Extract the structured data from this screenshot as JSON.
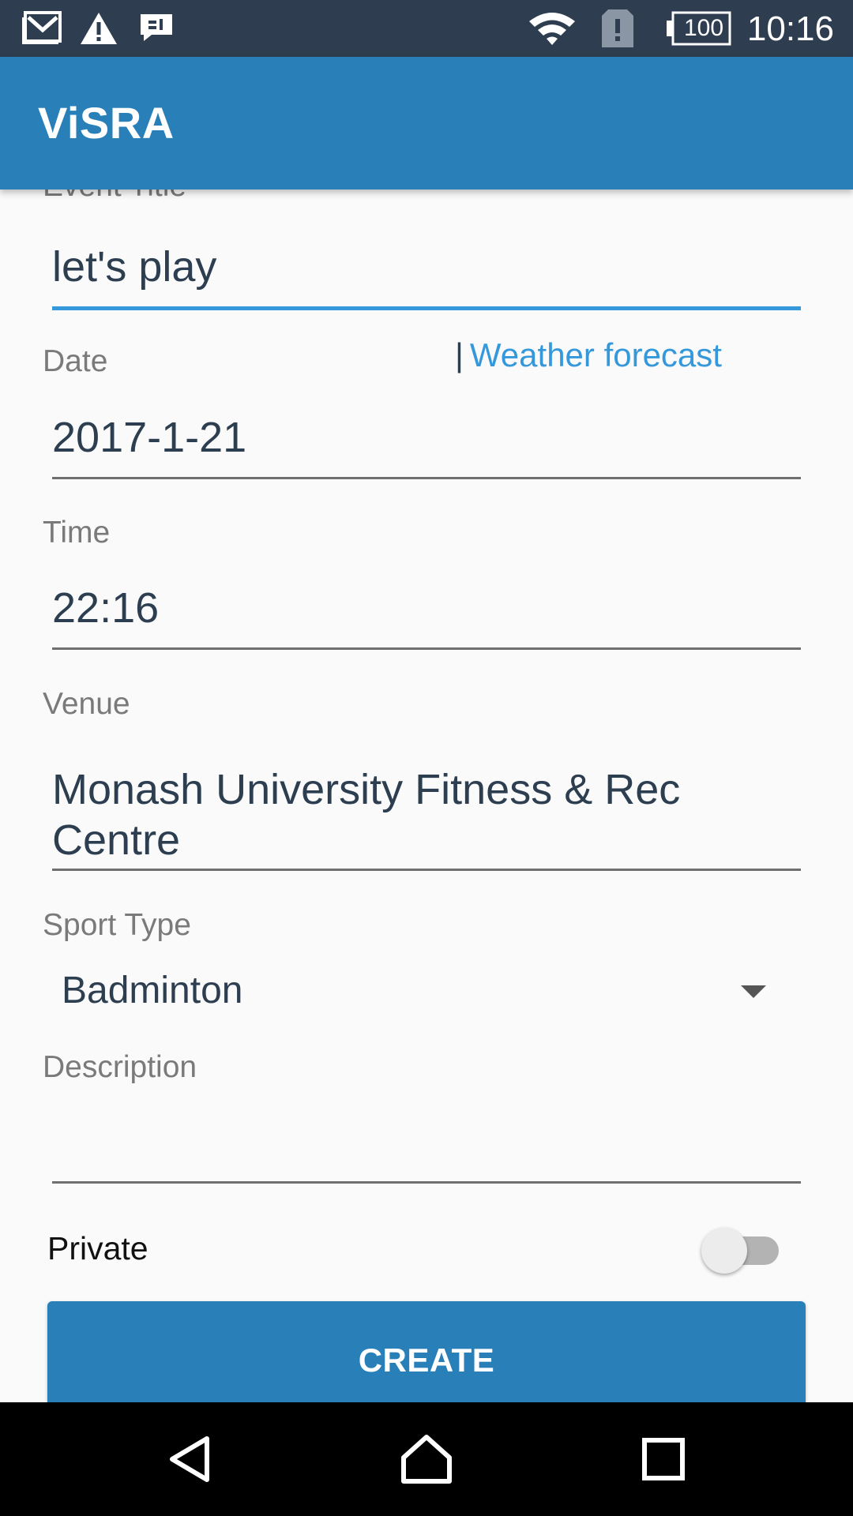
{
  "status_bar": {
    "time": "10:16",
    "battery_level": "100",
    "icons": [
      "gmail-icon",
      "warning-icon",
      "message-icon",
      "wifi-icon",
      "sim-alert-icon",
      "battery-icon"
    ]
  },
  "app_bar": {
    "title": "ViSRA"
  },
  "form": {
    "event_title_label": "Event Title",
    "event_title_value": "let's play",
    "date_label": "Date",
    "weather_separator": "|",
    "weather_link": "Weather forecast",
    "date_value": "2017-1-21",
    "time_label": "Time",
    "time_value": "22:16",
    "venue_label": "Venue",
    "venue_value_line1": "Monash University Fitness & Rec",
    "venue_value_line2": "Centre",
    "sport_type_label": "Sport Type",
    "sport_type_value": "Badminton",
    "description_label": "Description",
    "description_value": "",
    "private_label": "Private",
    "private_on": false,
    "create_label": "CREATE"
  },
  "nav_bar": {
    "icons": [
      "back-icon",
      "home-icon",
      "recents-icon"
    ]
  },
  "colors": {
    "status_bar": "#2e3e50",
    "primary": "#2980b9",
    "accent": "#3498db",
    "text_value": "#2c3e50"
  }
}
